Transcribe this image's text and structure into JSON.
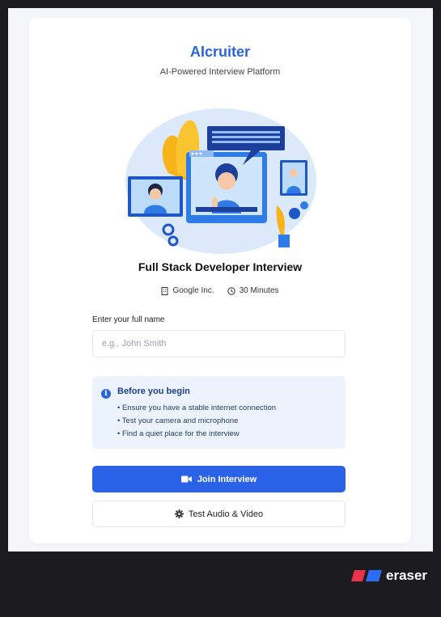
{
  "header": {
    "brand": "AIcruiter",
    "tagline": "AI-Powered Interview Platform"
  },
  "interview": {
    "title": "Full Stack Developer Interview",
    "company": "Google Inc.",
    "duration": "30 Minutes"
  },
  "form": {
    "name_label": "Enter your full name",
    "name_placeholder": "e.g., John Smith",
    "name_value": ""
  },
  "info": {
    "title": "Before you begin",
    "items": [
      "• Ensure you have a stable internet connection",
      "• Test your camera and microphone",
      "• Find a quiet place for the interview"
    ]
  },
  "actions": {
    "join_label": "Join Interview",
    "test_label": "Test Audio & Video"
  },
  "watermark": {
    "text": "eraser"
  },
  "colors": {
    "accent": "#2b63e8",
    "info_bg": "#edf3fd"
  }
}
